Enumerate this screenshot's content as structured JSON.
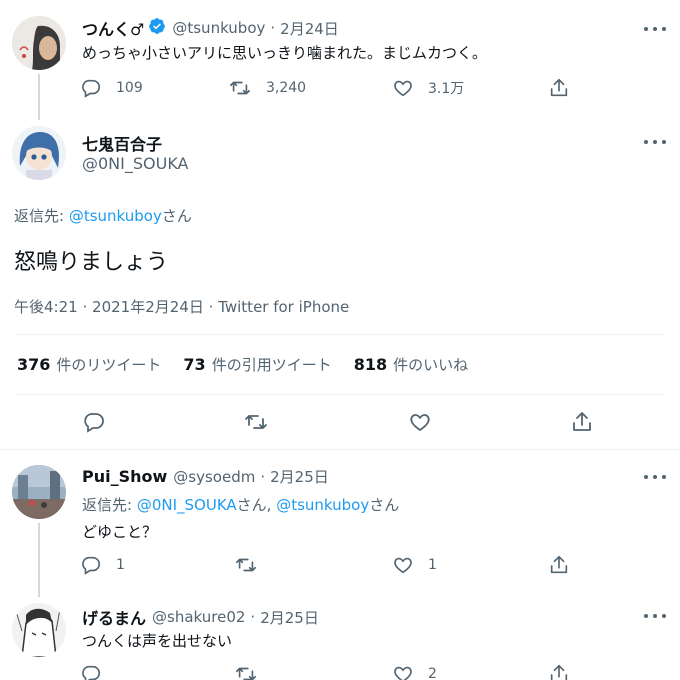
{
  "colors": {
    "accent": "#1d9bf0",
    "text": "#0f1419",
    "muted": "#536471",
    "divider": "#eff3f4"
  },
  "tweet1": {
    "name": "つんく♂",
    "handle": "@tsunkuboy",
    "sep": "·",
    "date": "2月24日",
    "text": "めっちゃ小さいアリに思いっきり噛まれた。まじムカつく。",
    "replies": "109",
    "retweets": "3,240",
    "likes": "3.1万"
  },
  "main": {
    "name": "七鬼百合子",
    "handle": "@0NI_SOUKA",
    "reply_prefix": "返信先: ",
    "reply_to": "@tsunkuboy",
    "reply_suffix": "さん",
    "text": "怒鳴りましょう",
    "meta_time": "午後4:21",
    "meta_date": "2021年2月24日",
    "meta_sep": "·",
    "meta_source": "Twitter for iPhone",
    "stats": [
      {
        "num": "376",
        "label": "件のリツイート"
      },
      {
        "num": "73",
        "label": "件の引用ツイート"
      },
      {
        "num": "818",
        "label": "件のいいね"
      }
    ]
  },
  "reply1": {
    "name": "Pui_Show",
    "handle": "@sysoedm",
    "sep": "·",
    "date": "2月25日",
    "reply_prefix": "返信先: ",
    "reply_to_1": "@0NI_SOUKA",
    "reply_mid": "さん, ",
    "reply_to_2": "@tsunkuboy",
    "reply_suffix": "さん",
    "text": "どゆこと？",
    "replies": "1",
    "likes": "1"
  },
  "reply2": {
    "name": "げるまん",
    "handle": "@shakure02",
    "sep": "·",
    "date": "2月25日",
    "text": "つんくは声を出せない",
    "likes": "2"
  }
}
